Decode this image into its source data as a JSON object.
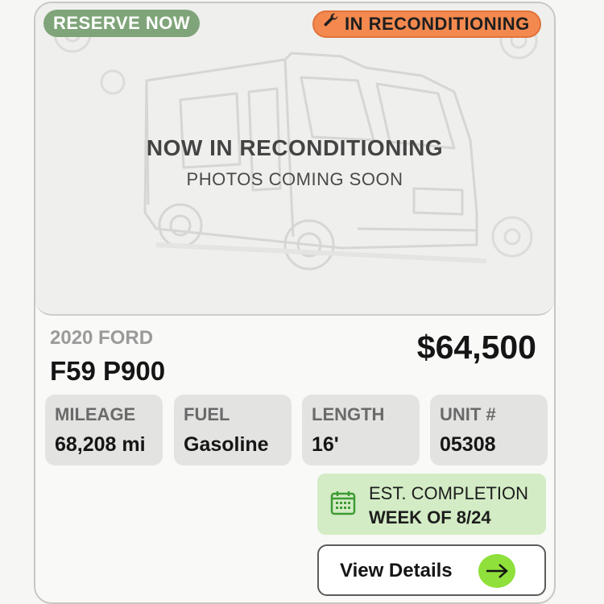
{
  "badges": {
    "reserve": "RESERVE NOW",
    "status": "IN RECONDITIONING",
    "status_icon": "wrench-icon"
  },
  "photo_overlay": {
    "title": "NOW IN RECONDITIONING",
    "subtitle": "PHOTOS COMING SOON"
  },
  "vehicle": {
    "year_make": "2020 FORD",
    "model": "F59 P900",
    "price": "$64,500"
  },
  "specs": [
    {
      "label": "MILEAGE",
      "value": "68,208 mi"
    },
    {
      "label": "FUEL",
      "value": "Gasoline"
    },
    {
      "label": "LENGTH",
      "value": "16'"
    },
    {
      "label": "UNIT #",
      "value": "05308"
    }
  ],
  "completion": {
    "icon": "calendar-icon",
    "label": "EST. COMPLETION",
    "value": "WEEK OF 8/24"
  },
  "details_button": {
    "label": "View Details",
    "icon": "arrow-right-icon"
  },
  "colors": {
    "reserve_badge": "#7fa479",
    "status_badge": "#f3894f",
    "completion_bg": "#d3ecc5",
    "arrow_button": "#8fe03a"
  }
}
